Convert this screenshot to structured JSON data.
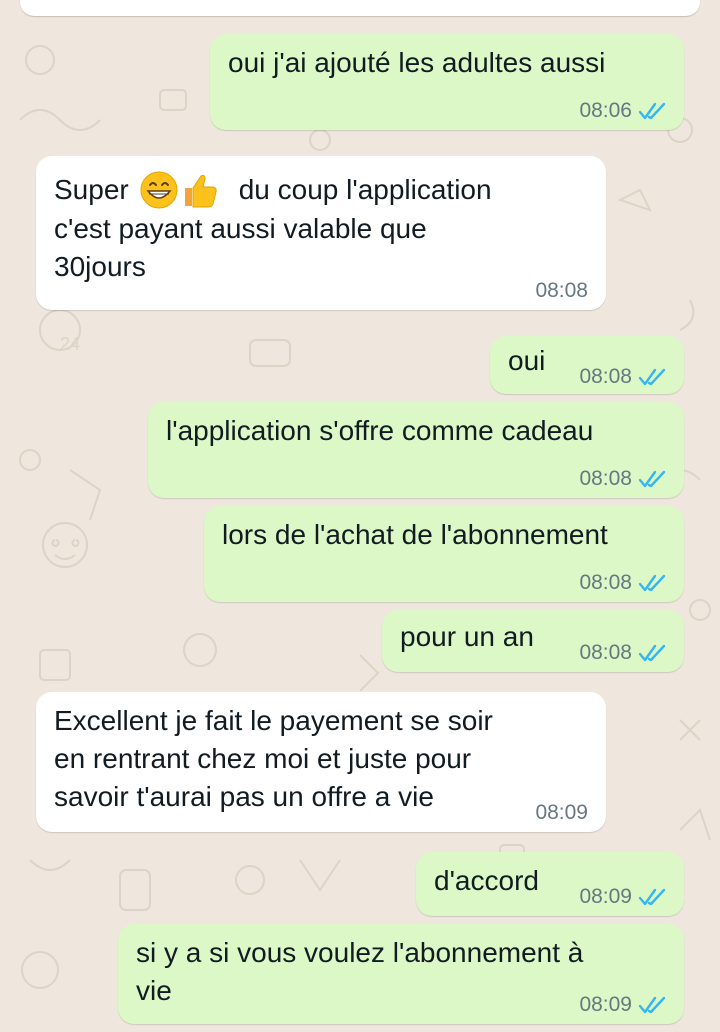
{
  "theme": {
    "wallpaper": "#efe7dd",
    "outgoing_bubble": "#dcf8c6",
    "incoming_bubble": "#ffffff",
    "tick_color": "#34b7f1",
    "meta_color": "#667781"
  },
  "messages": [
    {
      "direction": "out",
      "text": "oui j'ai ajouté les adultes aussi",
      "time": "08:06",
      "status": "read"
    },
    {
      "direction": "in",
      "prefix": "Super",
      "emojis": [
        "grinning-face-emoji",
        "thumbs-up-emoji"
      ],
      "lines": [
        "du coup l'application",
        "c'est payant aussi valable que",
        "30jours"
      ],
      "time": "08:08"
    },
    {
      "direction": "out",
      "text": "oui",
      "time": "08:08",
      "status": "read"
    },
    {
      "direction": "out",
      "text": "l'application s'offre comme cadeau",
      "time": "08:08",
      "status": "read"
    },
    {
      "direction": "out",
      "text": "lors de l'achat de l'abonnement",
      "time": "08:08",
      "status": "read"
    },
    {
      "direction": "out",
      "text": "pour un an",
      "time": "08:08",
      "status": "read"
    },
    {
      "direction": "in",
      "lines": [
        "Excellent je fait le payement se soir",
        "en rentrant chez moi et juste pour",
        "savoir t'aurai pas un offre a vie"
      ],
      "time": "08:09"
    },
    {
      "direction": "out",
      "text": "d'accord",
      "time": "08:09",
      "status": "read"
    },
    {
      "direction": "out",
      "lines": [
        "si y a si vous voulez l'abonnement à",
        "vie"
      ],
      "time": "08:09",
      "status": "read"
    }
  ]
}
